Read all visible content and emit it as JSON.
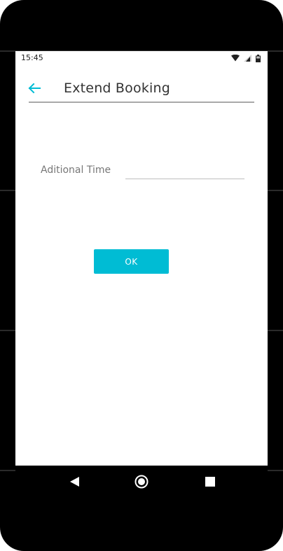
{
  "status_bar": {
    "time": "15:45",
    "icons": [
      "wifi-icon",
      "signal-icon",
      "battery-icon"
    ]
  },
  "app_bar": {
    "back_icon": "arrow-left-icon",
    "title": "Extend Booking"
  },
  "form": {
    "label": "Aditional Time",
    "value": "",
    "placeholder": ""
  },
  "actions": {
    "ok_label": "OK"
  },
  "nav_bar": {
    "icons": [
      "back-triangle-icon",
      "home-circle-icon",
      "recents-square-icon"
    ]
  },
  "colors": {
    "accent": "#00bcd4",
    "title_text": "#333333",
    "label_text": "#777777"
  }
}
